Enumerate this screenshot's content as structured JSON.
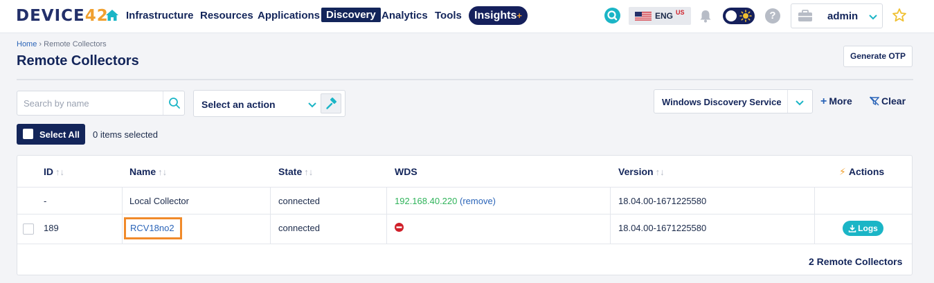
{
  "nav": {
    "logo_main": "DEVICE",
    "logo_accent": "42",
    "items": [
      "Infrastructure",
      "Resources",
      "Applications",
      "Discovery",
      "Analytics",
      "Tools"
    ],
    "active": "Discovery",
    "insights_label": "Insights",
    "insights_plus": "+",
    "language": "ENG",
    "language_region": "US",
    "user": "admin",
    "help_glyph": "?",
    "icons": [
      "home-icon",
      "search-icon",
      "us-flag-icon",
      "bell-icon",
      "theme-toggle-icon",
      "help-icon",
      "briefcase-icon",
      "chevron-down-icon",
      "star-icon"
    ],
    "accent_color": "#f0a030",
    "brand_color": "#13255a"
  },
  "header": {
    "breadcrumb_home": "Home",
    "breadcrumb_sep": "›",
    "breadcrumb_current": "Remote Collectors",
    "title": "Remote Collectors",
    "generate_otp": "Generate OTP"
  },
  "toolbar": {
    "search_placeholder": "Search by name",
    "action_select": "Select an action",
    "wds_select": "Windows Discovery Service",
    "more": "More",
    "more_plus": "+",
    "clear": "Clear",
    "select_all": "Select All",
    "items_selected": "0 items selected"
  },
  "table": {
    "columns": {
      "id": "ID",
      "name": "Name",
      "state": "State",
      "wds": "WDS",
      "version": "Version",
      "actions": "Actions"
    },
    "sort_glyph": "↑↓",
    "rows": [
      {
        "id": "-",
        "name": "Local Collector",
        "state": "connected",
        "wds_ip": "192.168.40.220",
        "wds_link": "(remove)",
        "version": "18.04.00-1671225580"
      },
      {
        "id": "189",
        "name": "RCV18no2",
        "state": "connected",
        "wds_status": "no-entry-icon",
        "version": "18.04.00-1671225580",
        "action": "Logs"
      }
    ],
    "footer": "2 Remote Collectors",
    "status_colors": {
      "ip": "#2fb35a",
      "error": "#d0202a",
      "logs_button": "#1bb5c6"
    }
  }
}
